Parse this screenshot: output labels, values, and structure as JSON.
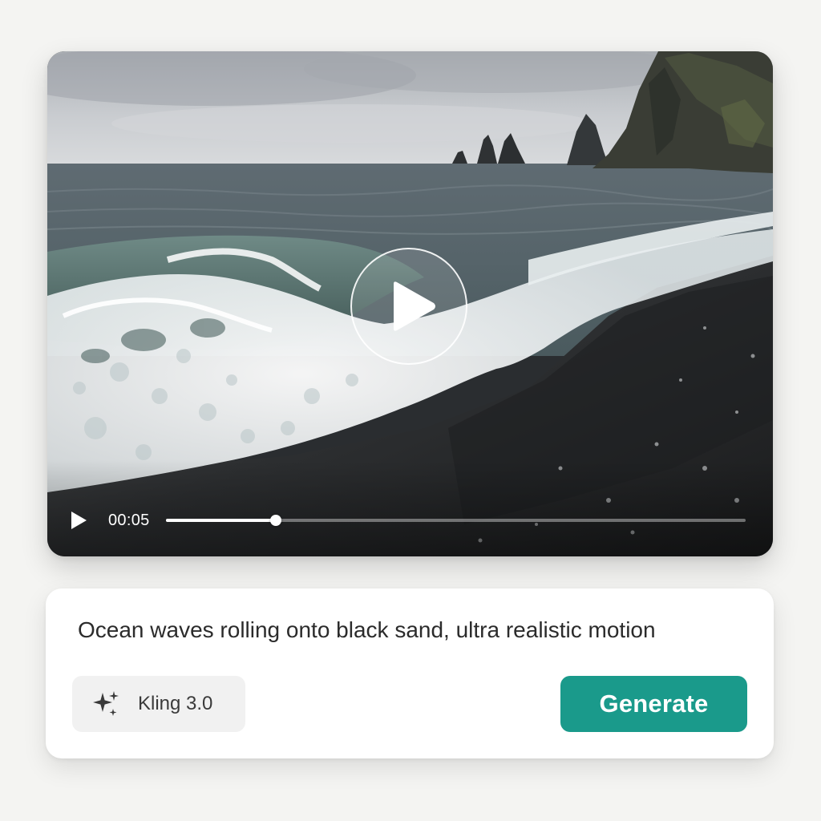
{
  "player": {
    "scene_icon": "ocean-waves-black-sand-beach",
    "play_icon": "play-icon",
    "timestamp": "00:05",
    "progress_fraction": 0.19
  },
  "prompt": {
    "text": "Ocean waves rolling onto black sand, ultra realistic motion"
  },
  "model": {
    "icon": "sparkle-icon",
    "label": "Kling 3.0"
  },
  "generate": {
    "label": "Generate",
    "color": "#1a9a8b"
  }
}
